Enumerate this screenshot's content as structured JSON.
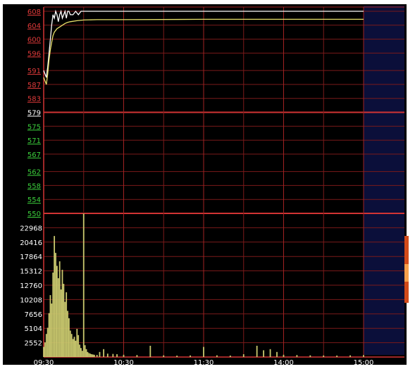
{
  "chart_data": [
    {
      "type": "line",
      "title": "",
      "y_tick_labels": [
        "608",
        "604",
        "600",
        "596",
        "591",
        "587",
        "583",
        "579",
        "575",
        "571",
        "567",
        "562",
        "558",
        "554",
        "550"
      ],
      "y_tick_values": [
        608,
        604,
        600,
        596,
        591,
        587,
        583,
        579,
        575,
        571,
        567,
        562,
        558,
        554,
        550
      ],
      "y_tick_colors": [
        "red",
        "red",
        "red",
        "red",
        "red",
        "red",
        "red",
        "white",
        "green",
        "green",
        "green",
        "green",
        "green",
        "green",
        "green"
      ],
      "reference_price": 579,
      "ylim": [
        550,
        608
      ],
      "x_tick_labels": [
        "09:30",
        "10:30",
        "11:30",
        "14:00",
        "15:00"
      ],
      "x_minutes": [
        0,
        60,
        120,
        180,
        240
      ],
      "xlim": [
        0,
        240
      ],
      "grid": true,
      "series": [
        {
          "role": "price",
          "color": "#ffffff",
          "x": [
            0,
            1,
            2,
            3,
            4,
            5,
            6,
            7,
            8,
            9,
            10,
            11,
            12,
            13,
            14,
            15,
            16,
            17,
            18,
            19,
            20,
            22,
            24,
            26,
            28,
            30,
            35,
            40,
            60,
            120,
            240
          ],
          "y": [
            591,
            590,
            589,
            592,
            596,
            600,
            604,
            607,
            606,
            608,
            607,
            605,
            607,
            608,
            606,
            607,
            608,
            606,
            608,
            608,
            607,
            607,
            608,
            607,
            608,
            608,
            608,
            608,
            608,
            608,
            608
          ]
        },
        {
          "role": "average",
          "color": "#e8e06a",
          "x": [
            0,
            1,
            2,
            3,
            4,
            5,
            6,
            7,
            8,
            9,
            10,
            12,
            14,
            16,
            18,
            20,
            25,
            30,
            40,
            60,
            120,
            180,
            240
          ],
          "y": [
            589,
            588,
            587,
            590,
            594,
            597,
            599,
            601,
            602,
            602.5,
            603,
            603.5,
            604,
            604.5,
            604.8,
            605,
            605.3,
            605.5,
            605.6,
            605.6,
            605.7,
            605.7,
            605.7
          ]
        }
      ]
    },
    {
      "type": "bar",
      "title": "",
      "y_tick_labels": [
        "22968",
        "20416",
        "17864",
        "15312",
        "12760",
        "10208",
        "7656",
        "5104",
        "2552"
      ],
      "y_tick_values": [
        22968,
        20416,
        17864,
        15312,
        12760,
        10208,
        7656,
        5104,
        2552
      ],
      "ylim": [
        0,
        25520
      ],
      "bar_color": "#c9c86e",
      "series": [
        {
          "name": "volume",
          "x": [
            0,
            1,
            2,
            3,
            4,
            5,
            6,
            7,
            8,
            9,
            10,
            11,
            12,
            13,
            14,
            15,
            16,
            17,
            18,
            19,
            20,
            21,
            22,
            23,
            24,
            25,
            26,
            27,
            28,
            29,
            30,
            31,
            32,
            33,
            34,
            35,
            36,
            37,
            38,
            40,
            42,
            45,
            48,
            52,
            55,
            60,
            70,
            80,
            90,
            100,
            110,
            120,
            130,
            140,
            150,
            160,
            165,
            170,
            175,
            180,
            190,
            200,
            210,
            220,
            230,
            240
          ],
          "y": [
            1800,
            2600,
            4100,
            5200,
            7800,
            11000,
            9500,
            15000,
            21500,
            18500,
            16200,
            14000,
            17000,
            12000,
            15500,
            13000,
            9800,
            11500,
            8200,
            6900,
            4700,
            4100,
            3200,
            3600,
            2900,
            5000,
            3900,
            2200,
            1600,
            1100,
            25500,
            2100,
            1400,
            900,
            700,
            600,
            500,
            450,
            400,
            380,
            900,
            1400,
            600,
            550,
            500,
            400,
            350,
            2000,
            300,
            250,
            280,
            1800,
            300,
            260,
            500,
            2000,
            1200,
            1400,
            900,
            400,
            350,
            300,
            280,
            260,
            300,
            350
          ]
        }
      ]
    }
  ]
}
